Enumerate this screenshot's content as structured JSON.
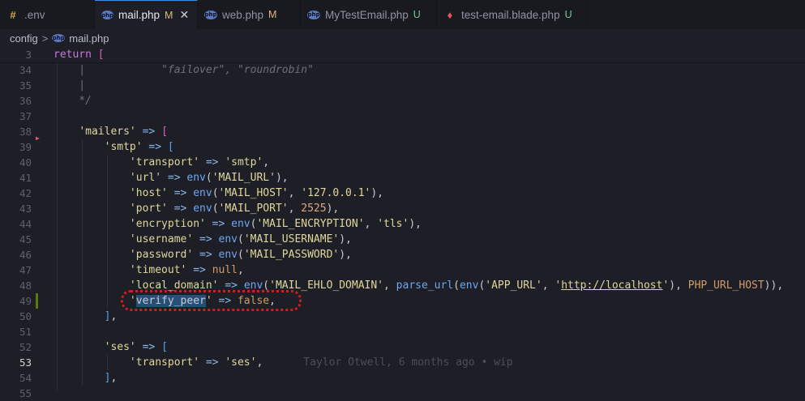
{
  "tabs": [
    {
      "icon": "env-file-icon",
      "icon_glyph": "#",
      "label": ".env",
      "badge": "",
      "badge_type": "",
      "active": false
    },
    {
      "icon": "php-file-icon",
      "icon_glyph": "php",
      "label": "mail.php",
      "badge": "M",
      "badge_type": "m",
      "active": true,
      "close": "✕"
    },
    {
      "icon": "php-file-icon",
      "icon_glyph": "php",
      "label": "web.php",
      "badge": "M",
      "badge_type": "m",
      "active": false
    },
    {
      "icon": "php-file-icon",
      "icon_glyph": "php",
      "label": "MyTestEmail.php",
      "badge": "U",
      "badge_type": "u",
      "active": false
    },
    {
      "icon": "laravel-blade-icon",
      "icon_glyph": "♦",
      "label": "test-email.blade.php",
      "badge": "U",
      "badge_type": "u",
      "active": false
    }
  ],
  "breadcrumb": {
    "folder": "config",
    "separator": ">",
    "file_icon": "php",
    "file": "mail.php"
  },
  "editor": {
    "sticky_line": "3",
    "blame": "Taylor Otwell, 6 months ago • wip",
    "current_line": "53",
    "modified_line": "49",
    "lines": [
      {
        "n": "3",
        "tokens": [
          [
            "kw",
            "return"
          ],
          [
            "pn",
            " "
          ],
          [
            "bk",
            "["
          ]
        ]
      },
      {
        "n": "34",
        "tokens": [
          [
            "cm",
            "    |            \"failover\", \"roundrobin\""
          ]
        ]
      },
      {
        "n": "35",
        "tokens": [
          [
            "cm",
            "    |"
          ]
        ]
      },
      {
        "n": "36",
        "tokens": [
          [
            "cm",
            "    */"
          ]
        ]
      },
      {
        "n": "37",
        "tokens": []
      },
      {
        "n": "38",
        "tokens": [
          [
            "pn",
            "    "
          ],
          [
            "str",
            "'mailers'"
          ],
          [
            "pn",
            " "
          ],
          [
            "op",
            "=>"
          ],
          [
            "pn",
            " "
          ],
          [
            "bk",
            "["
          ]
        ]
      },
      {
        "n": "39",
        "tokens": [
          [
            "pn",
            "        "
          ],
          [
            "str",
            "'smtp'"
          ],
          [
            "pn",
            " "
          ],
          [
            "op",
            "=>"
          ],
          [
            "pn",
            " "
          ],
          [
            "bk2",
            "["
          ]
        ]
      },
      {
        "n": "40",
        "tokens": [
          [
            "pn",
            "            "
          ],
          [
            "str",
            "'transport'"
          ],
          [
            "pn",
            " "
          ],
          [
            "op",
            "=>"
          ],
          [
            "pn",
            " "
          ],
          [
            "str",
            "'smtp'"
          ],
          [
            "pn",
            ","
          ]
        ]
      },
      {
        "n": "41",
        "tokens": [
          [
            "pn",
            "            "
          ],
          [
            "str",
            "'url'"
          ],
          [
            "pn",
            " "
          ],
          [
            "op",
            "=>"
          ],
          [
            "pn",
            " "
          ],
          [
            "fn",
            "env"
          ],
          [
            "pn",
            "("
          ],
          [
            "str",
            "'MAIL_URL'"
          ],
          [
            "pn",
            "),"
          ]
        ]
      },
      {
        "n": "42",
        "tokens": [
          [
            "pn",
            "            "
          ],
          [
            "str",
            "'host'"
          ],
          [
            "pn",
            " "
          ],
          [
            "op",
            "=>"
          ],
          [
            "pn",
            " "
          ],
          [
            "fn",
            "env"
          ],
          [
            "pn",
            "("
          ],
          [
            "str",
            "'MAIL_HOST'"
          ],
          [
            "pn",
            ", "
          ],
          [
            "str",
            "'127.0.0.1'"
          ],
          [
            "pn",
            "),"
          ]
        ]
      },
      {
        "n": "43",
        "tokens": [
          [
            "pn",
            "            "
          ],
          [
            "str",
            "'port'"
          ],
          [
            "pn",
            " "
          ],
          [
            "op",
            "=>"
          ],
          [
            "pn",
            " "
          ],
          [
            "fn",
            "env"
          ],
          [
            "pn",
            "("
          ],
          [
            "str",
            "'MAIL_PORT'"
          ],
          [
            "pn",
            ", "
          ],
          [
            "num",
            "2525"
          ],
          [
            "pn",
            "),"
          ]
        ]
      },
      {
        "n": "44",
        "tokens": [
          [
            "pn",
            "            "
          ],
          [
            "str",
            "'encryption'"
          ],
          [
            "pn",
            " "
          ],
          [
            "op",
            "=>"
          ],
          [
            "pn",
            " "
          ],
          [
            "fn",
            "env"
          ],
          [
            "pn",
            "("
          ],
          [
            "str",
            "'MAIL_ENCRYPTION'"
          ],
          [
            "pn",
            ", "
          ],
          [
            "str",
            "'tls'"
          ],
          [
            "pn",
            "),"
          ]
        ]
      },
      {
        "n": "45",
        "tokens": [
          [
            "pn",
            "            "
          ],
          [
            "str",
            "'username'"
          ],
          [
            "pn",
            " "
          ],
          [
            "op",
            "=>"
          ],
          [
            "pn",
            " "
          ],
          [
            "fn",
            "env"
          ],
          [
            "pn",
            "("
          ],
          [
            "str",
            "'MAIL_USERNAME'"
          ],
          [
            "pn",
            "),"
          ]
        ]
      },
      {
        "n": "46",
        "tokens": [
          [
            "pn",
            "            "
          ],
          [
            "str",
            "'password'"
          ],
          [
            "pn",
            " "
          ],
          [
            "op",
            "=>"
          ],
          [
            "pn",
            " "
          ],
          [
            "fn",
            "env"
          ],
          [
            "pn",
            "("
          ],
          [
            "str",
            "'MAIL_PASSWORD'"
          ],
          [
            "pn",
            "),"
          ]
        ]
      },
      {
        "n": "47",
        "tokens": [
          [
            "pn",
            "            "
          ],
          [
            "str",
            "'timeout'"
          ],
          [
            "pn",
            " "
          ],
          [
            "op",
            "=>"
          ],
          [
            "pn",
            " "
          ],
          [
            "cst",
            "null"
          ],
          [
            "pn",
            ","
          ]
        ]
      },
      {
        "n": "48",
        "tokens": [
          [
            "pn",
            "            "
          ],
          [
            "str",
            "'local_domain'"
          ],
          [
            "pn",
            " "
          ],
          [
            "op",
            "=>"
          ],
          [
            "pn",
            " "
          ],
          [
            "fn",
            "env"
          ],
          [
            "pn",
            "("
          ],
          [
            "str",
            "'MAIL_EHLO_DOMAIN'"
          ],
          [
            "pn",
            ", "
          ],
          [
            "fn",
            "parse_url"
          ],
          [
            "pn",
            "("
          ],
          [
            "fn",
            "env"
          ],
          [
            "pn",
            "("
          ],
          [
            "str",
            "'APP_URL'"
          ],
          [
            "pn",
            ", "
          ],
          [
            "str",
            "'"
          ],
          [
            "lnk",
            "http://localhost"
          ],
          [
            "str",
            "'"
          ],
          [
            "pn",
            "), "
          ],
          [
            "cst",
            "PHP_URL_HOST"
          ],
          [
            "pn",
            ")),"
          ]
        ]
      },
      {
        "n": "49",
        "tokens": [
          [
            "pn",
            "            "
          ],
          [
            "str",
            "'"
          ],
          [
            "hl",
            "verify_peer"
          ],
          [
            "str",
            "'"
          ],
          [
            "pn",
            " "
          ],
          [
            "op",
            "=>"
          ],
          [
            "pn",
            " "
          ],
          [
            "cst",
            "false"
          ],
          [
            "pn",
            ","
          ]
        ]
      },
      {
        "n": "50",
        "tokens": [
          [
            "pn",
            "        "
          ],
          [
            "bk2",
            "]"
          ],
          [
            "pn",
            ","
          ]
        ]
      },
      {
        "n": "51",
        "tokens": []
      },
      {
        "n": "52",
        "tokens": [
          [
            "pn",
            "        "
          ],
          [
            "str",
            "'ses'"
          ],
          [
            "pn",
            " "
          ],
          [
            "op",
            "=>"
          ],
          [
            "pn",
            " "
          ],
          [
            "bk2",
            "["
          ]
        ]
      },
      {
        "n": "53",
        "tokens": [
          [
            "pn",
            "            "
          ],
          [
            "str",
            "'transport'"
          ],
          [
            "pn",
            " "
          ],
          [
            "op",
            "=>"
          ],
          [
            "pn",
            " "
          ],
          [
            "str",
            "'ses'"
          ],
          [
            "pn",
            ","
          ]
        ]
      },
      {
        "n": "54",
        "tokens": [
          [
            "pn",
            "        "
          ],
          [
            "bk2",
            "]"
          ],
          [
            "pn",
            ","
          ]
        ]
      },
      {
        "n": "55",
        "tokens": []
      }
    ]
  },
  "colors": {
    "accent": "#3a8ee6",
    "annotation": "#d21d1d",
    "modified": "#587c0c",
    "background": "#1e1f26"
  }
}
